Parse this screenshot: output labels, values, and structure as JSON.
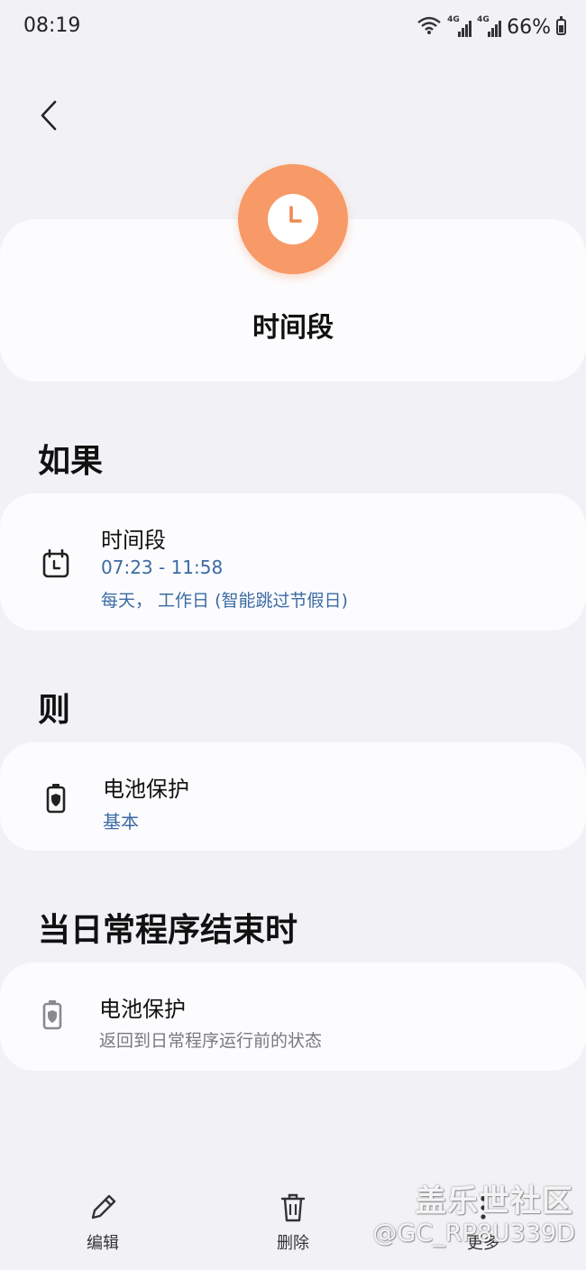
{
  "status_bar": {
    "time": "08:19",
    "network_1": "4G",
    "network_2": "4G",
    "battery_percent": "66%"
  },
  "header": {
    "icon": "clock-icon",
    "icon_color": "#f79a67",
    "title": "时间段"
  },
  "if_section": {
    "heading": "如果",
    "card": {
      "icon": "calendar-icon",
      "title": "时间段",
      "time_range": "07:23 - 11:58",
      "repeat": "每天， 工作日 (智能跳过节假日)"
    }
  },
  "then_section": {
    "heading": "则",
    "card": {
      "icon": "battery-shield-icon",
      "title": "电池保护",
      "value": "基本"
    }
  },
  "end_section": {
    "heading": "当日常程序结束时",
    "card": {
      "icon": "battery-shield-icon",
      "title": "电池保护",
      "description": "返回到日常程序运行前的状态"
    }
  },
  "bottom_bar": {
    "edit_label": "编辑",
    "delete_label": "删除",
    "more_label": "更多"
  },
  "watermark": {
    "line1": "盖乐世社区",
    "line2": "@GC_RP8U339D"
  },
  "colors": {
    "accent_blue": "#3c6aa3",
    "background": "#f2f2f6",
    "card": "#fcfcfe"
  }
}
